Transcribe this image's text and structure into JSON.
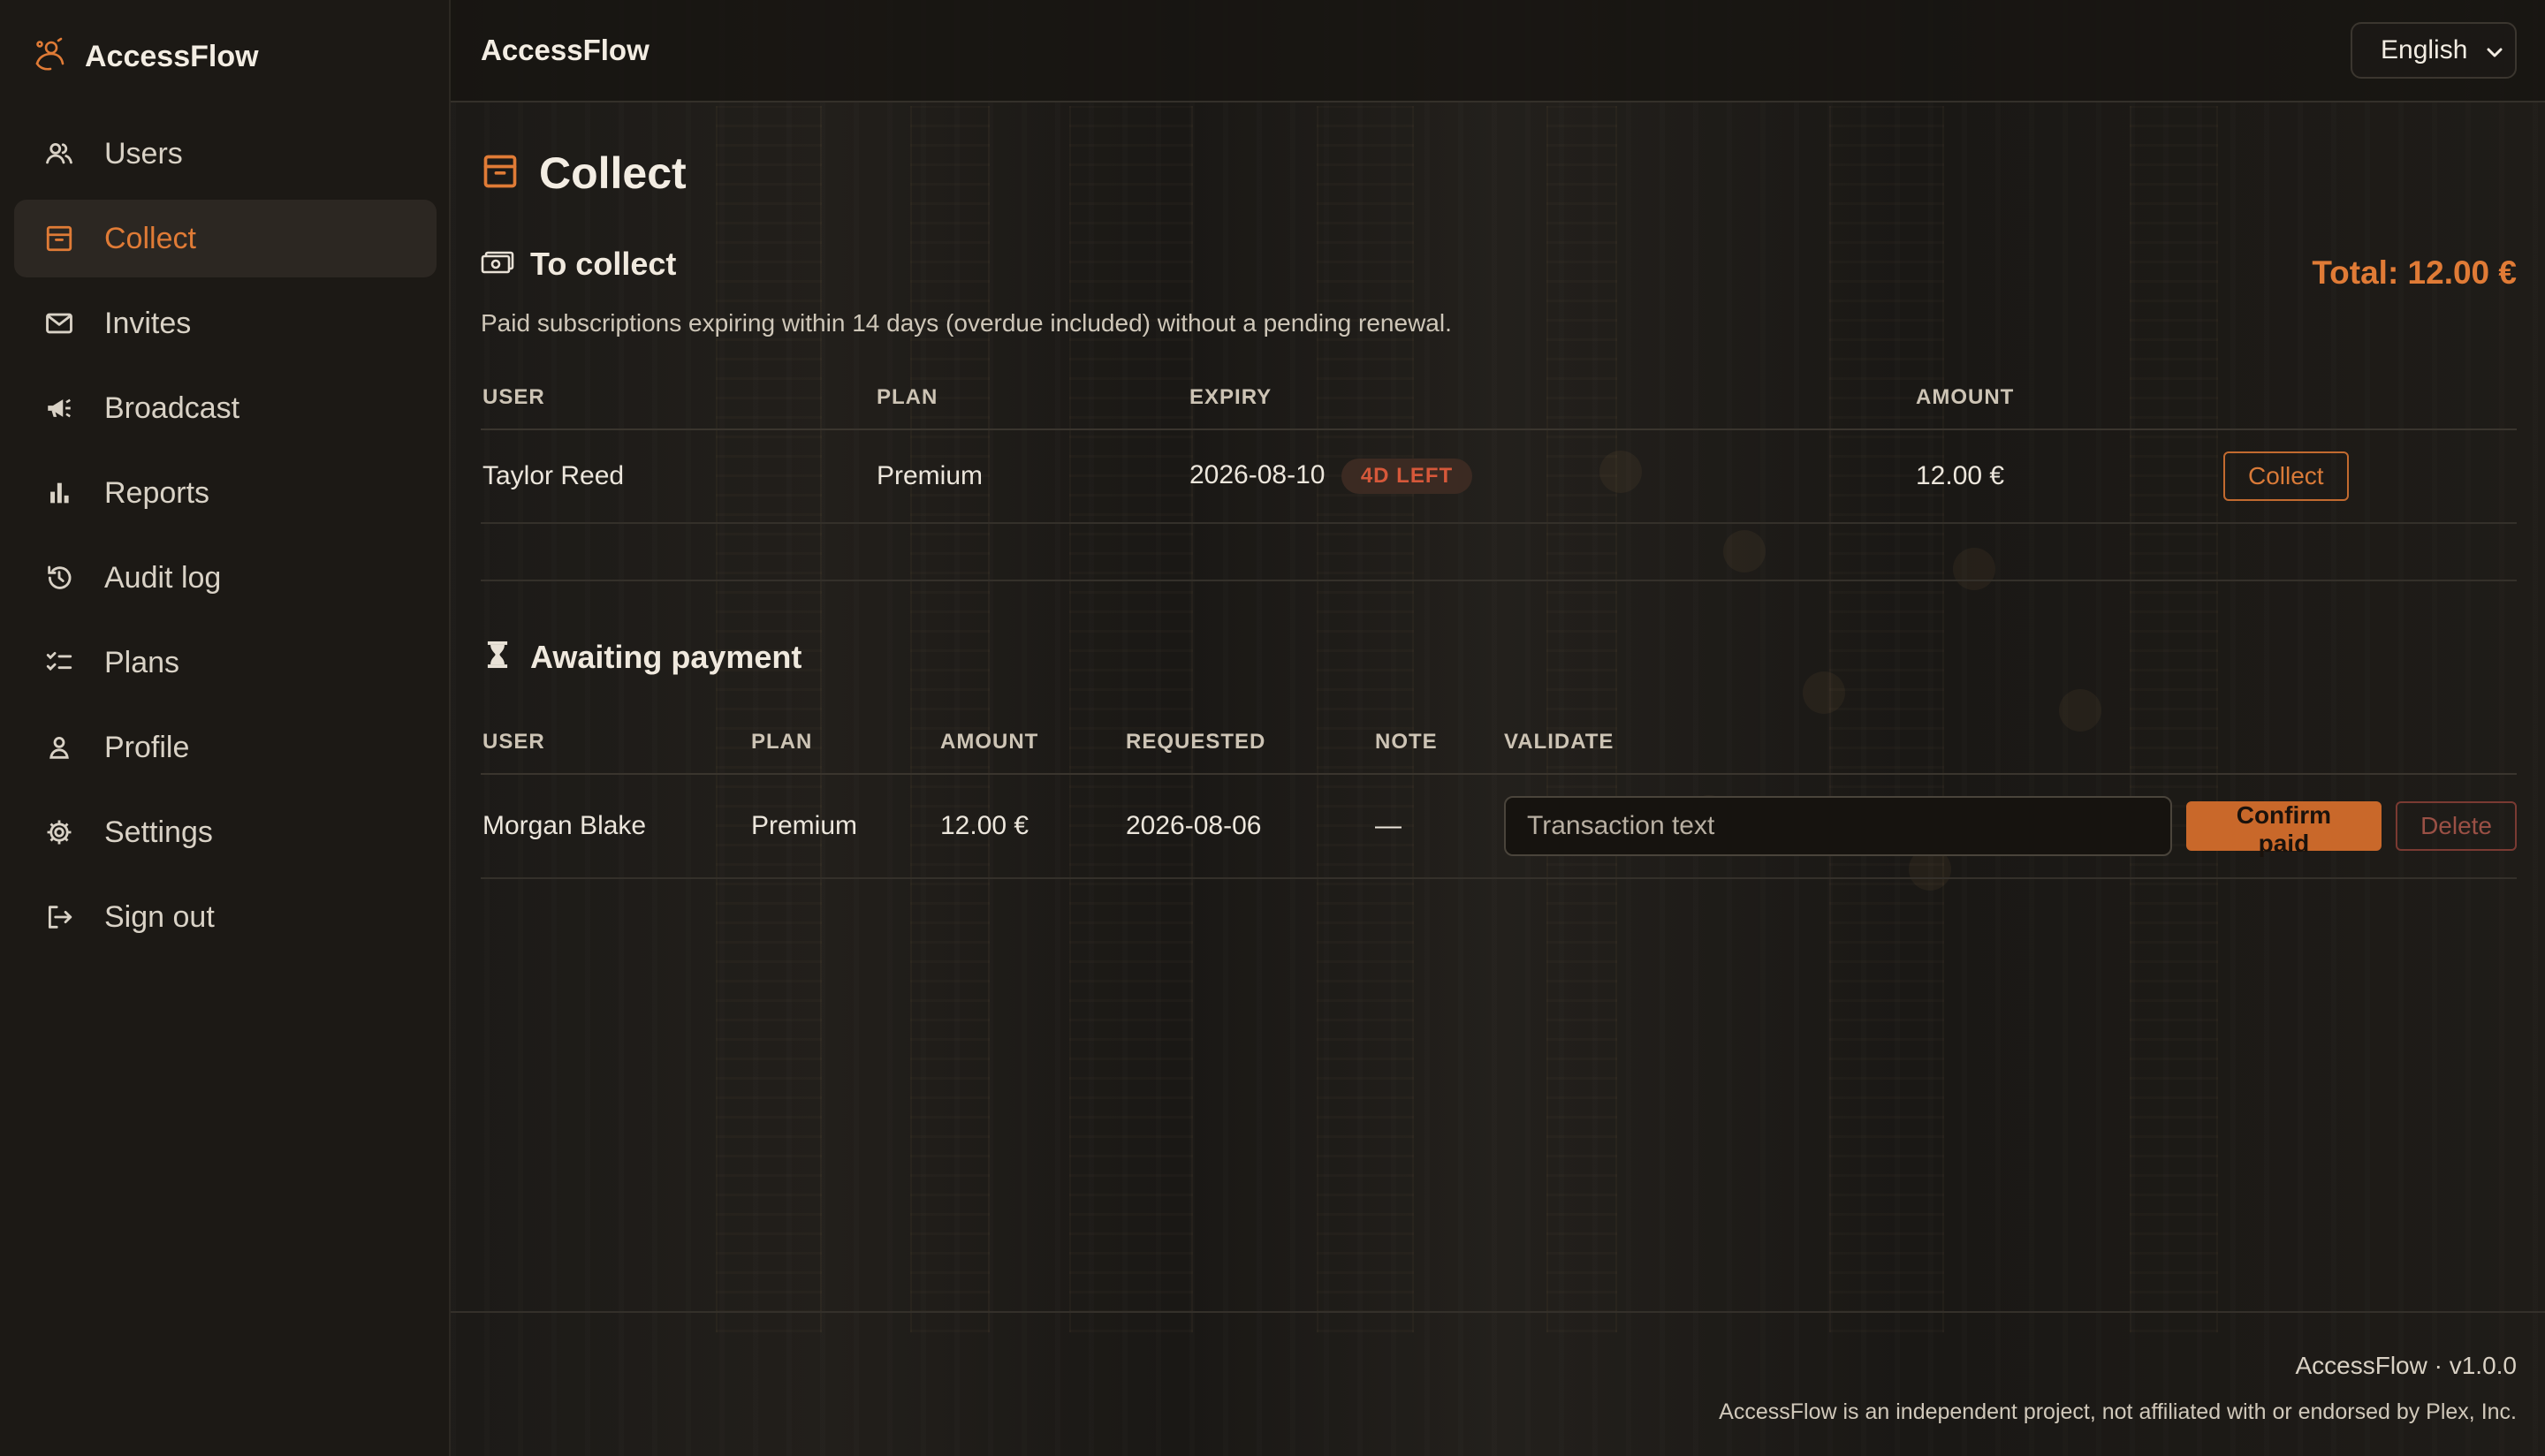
{
  "app": {
    "name": "AccessFlow",
    "accent": "#e07b36"
  },
  "sidebar": {
    "items": [
      {
        "label": "Users",
        "icon": "users-icon",
        "active": false
      },
      {
        "label": "Collect",
        "icon": "archive-icon",
        "active": true
      },
      {
        "label": "Invites",
        "icon": "mail-icon",
        "active": false
      },
      {
        "label": "Broadcast",
        "icon": "megaphone-icon",
        "active": false
      },
      {
        "label": "Reports",
        "icon": "bar-chart-icon",
        "active": false
      },
      {
        "label": "Audit log",
        "icon": "history-icon",
        "active": false
      },
      {
        "label": "Plans",
        "icon": "checklist-icon",
        "active": false
      },
      {
        "label": "Profile",
        "icon": "person-icon",
        "active": false
      },
      {
        "label": "Settings",
        "icon": "gear-icon",
        "active": false
      },
      {
        "label": "Sign out",
        "icon": "sign-out-icon",
        "active": false
      }
    ]
  },
  "topbar": {
    "title": "AccessFlow",
    "language": "English"
  },
  "page": {
    "title": "Collect"
  },
  "to_collect": {
    "title": "To collect",
    "total": "Total: 12.00 €",
    "description": "Paid subscriptions expiring within 14 days (overdue included) without a pending renewal.",
    "columns": [
      "USER",
      "PLAN",
      "EXPIRY",
      "AMOUNT"
    ],
    "rows": [
      {
        "user": "Taylor Reed",
        "plan": "Premium",
        "expiry": "2026-08-10",
        "badge": "4D LEFT",
        "amount": "12.00 €",
        "action": "Collect"
      }
    ]
  },
  "awaiting": {
    "title": "Awaiting payment",
    "columns": [
      "USER",
      "PLAN",
      "AMOUNT",
      "REQUESTED",
      "NOTE",
      "VALIDATE"
    ],
    "rows": [
      {
        "user": "Morgan Blake",
        "plan": "Premium",
        "amount": "12.00 €",
        "requested": "2026-08-06",
        "note": "—",
        "input_placeholder": "Transaction text",
        "confirm": "Confirm paid",
        "delete": "Delete"
      }
    ]
  },
  "footer": {
    "version": "AccessFlow · v1.0.0",
    "disclaimer": "AccessFlow is an independent project, not affiliated with or endorsed by Plex, Inc."
  }
}
